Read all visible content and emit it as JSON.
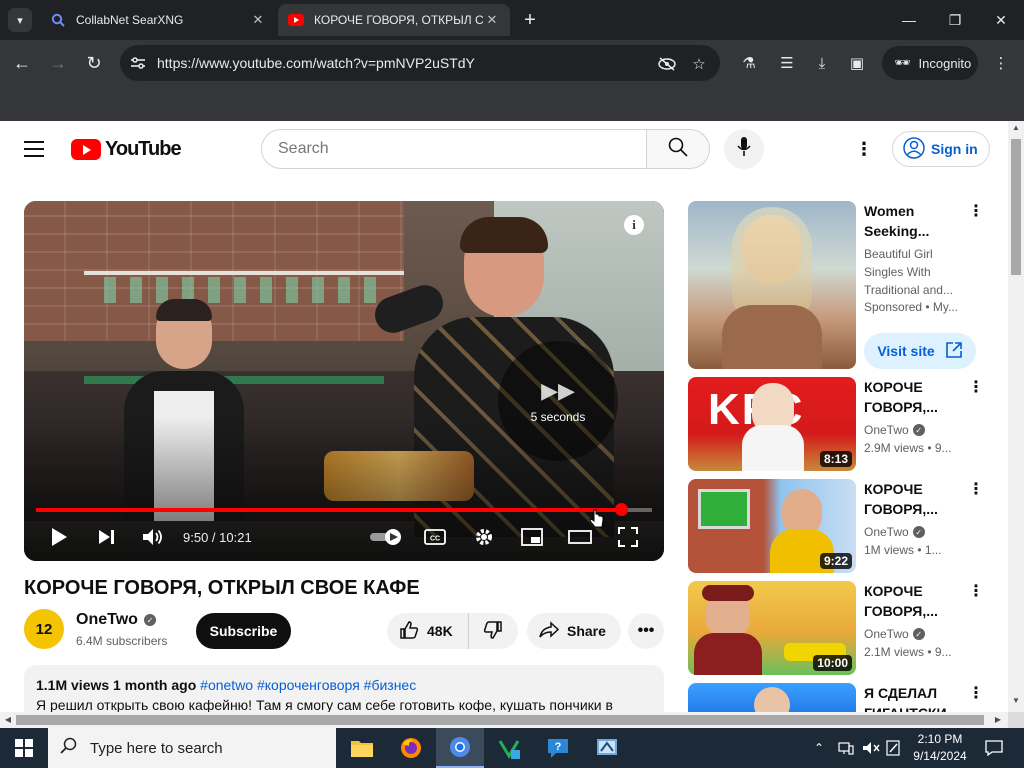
{
  "browser": {
    "tabs": [
      {
        "title": "CollabNet SearXNG",
        "active": false
      },
      {
        "title": "КОРОЧЕ ГОВОРЯ, ОТКРЫЛ СВ",
        "active": true
      }
    ],
    "url": "https://www.youtube.com/watch?v=pmNVP2uSTdY",
    "profile_label": "Incognito"
  },
  "youtube": {
    "logo_text": "YouTube",
    "search_placeholder": "Search",
    "sign_in_label": "Sign in",
    "player": {
      "autoplay_countdown": "5 seconds",
      "time_display": "9:50 / 10:21",
      "progress_fraction": 0.95
    },
    "video": {
      "title": "КОРОЧЕ ГОВОРЯ, ОТКРЫЛ СВОЕ КАФЕ",
      "channel_name": "OneTwo",
      "channel_avatar_text": "12",
      "subscribers": "6.4M subscribers",
      "subscribe_label": "Subscribe",
      "likes": "48K",
      "share_label": "Share",
      "views_date": "1.1M views  1 month ago",
      "hashtags": "#onetwo #короченговоря #бизнес",
      "description": "Я решил открыть свою кафейню! Там я смогу сам себе готовить кофе, кушать пончики в"
    },
    "sidebar": [
      {
        "title": "Women Seeking...",
        "channel": "Beautiful Girl Singles With Traditional and...",
        "views": "Sponsored • My...",
        "sponsored": true,
        "cta": "Visit site",
        "duration": ""
      },
      {
        "title": "КОРОЧЕ ГОВОРЯ,...",
        "channel": "OneTwo",
        "views": "2.9M views • 9...",
        "duration": "8:13"
      },
      {
        "title": "КОРОЧЕ ГОВОРЯ,...",
        "channel": "OneTwo",
        "views": "1M views • 1...",
        "duration": "9:22"
      },
      {
        "title": "КОРОЧЕ ГОВОРЯ,...",
        "channel": "OneTwo",
        "views": "2.1M views • 9...",
        "duration": "10:00"
      },
      {
        "title": "Я СДЕЛАЛ ГИГАНТСКИ...",
        "channel": "",
        "views": "",
        "duration": ""
      }
    ]
  },
  "taskbar": {
    "search_placeholder": "Type here to search",
    "time": "2:10 PM",
    "date": "9/14/2024"
  },
  "colors": {
    "brand_red": "#ff0000",
    "link_blue": "#065fd4",
    "chrome_dark": "#202124",
    "taskbar": "#1c2a38"
  }
}
